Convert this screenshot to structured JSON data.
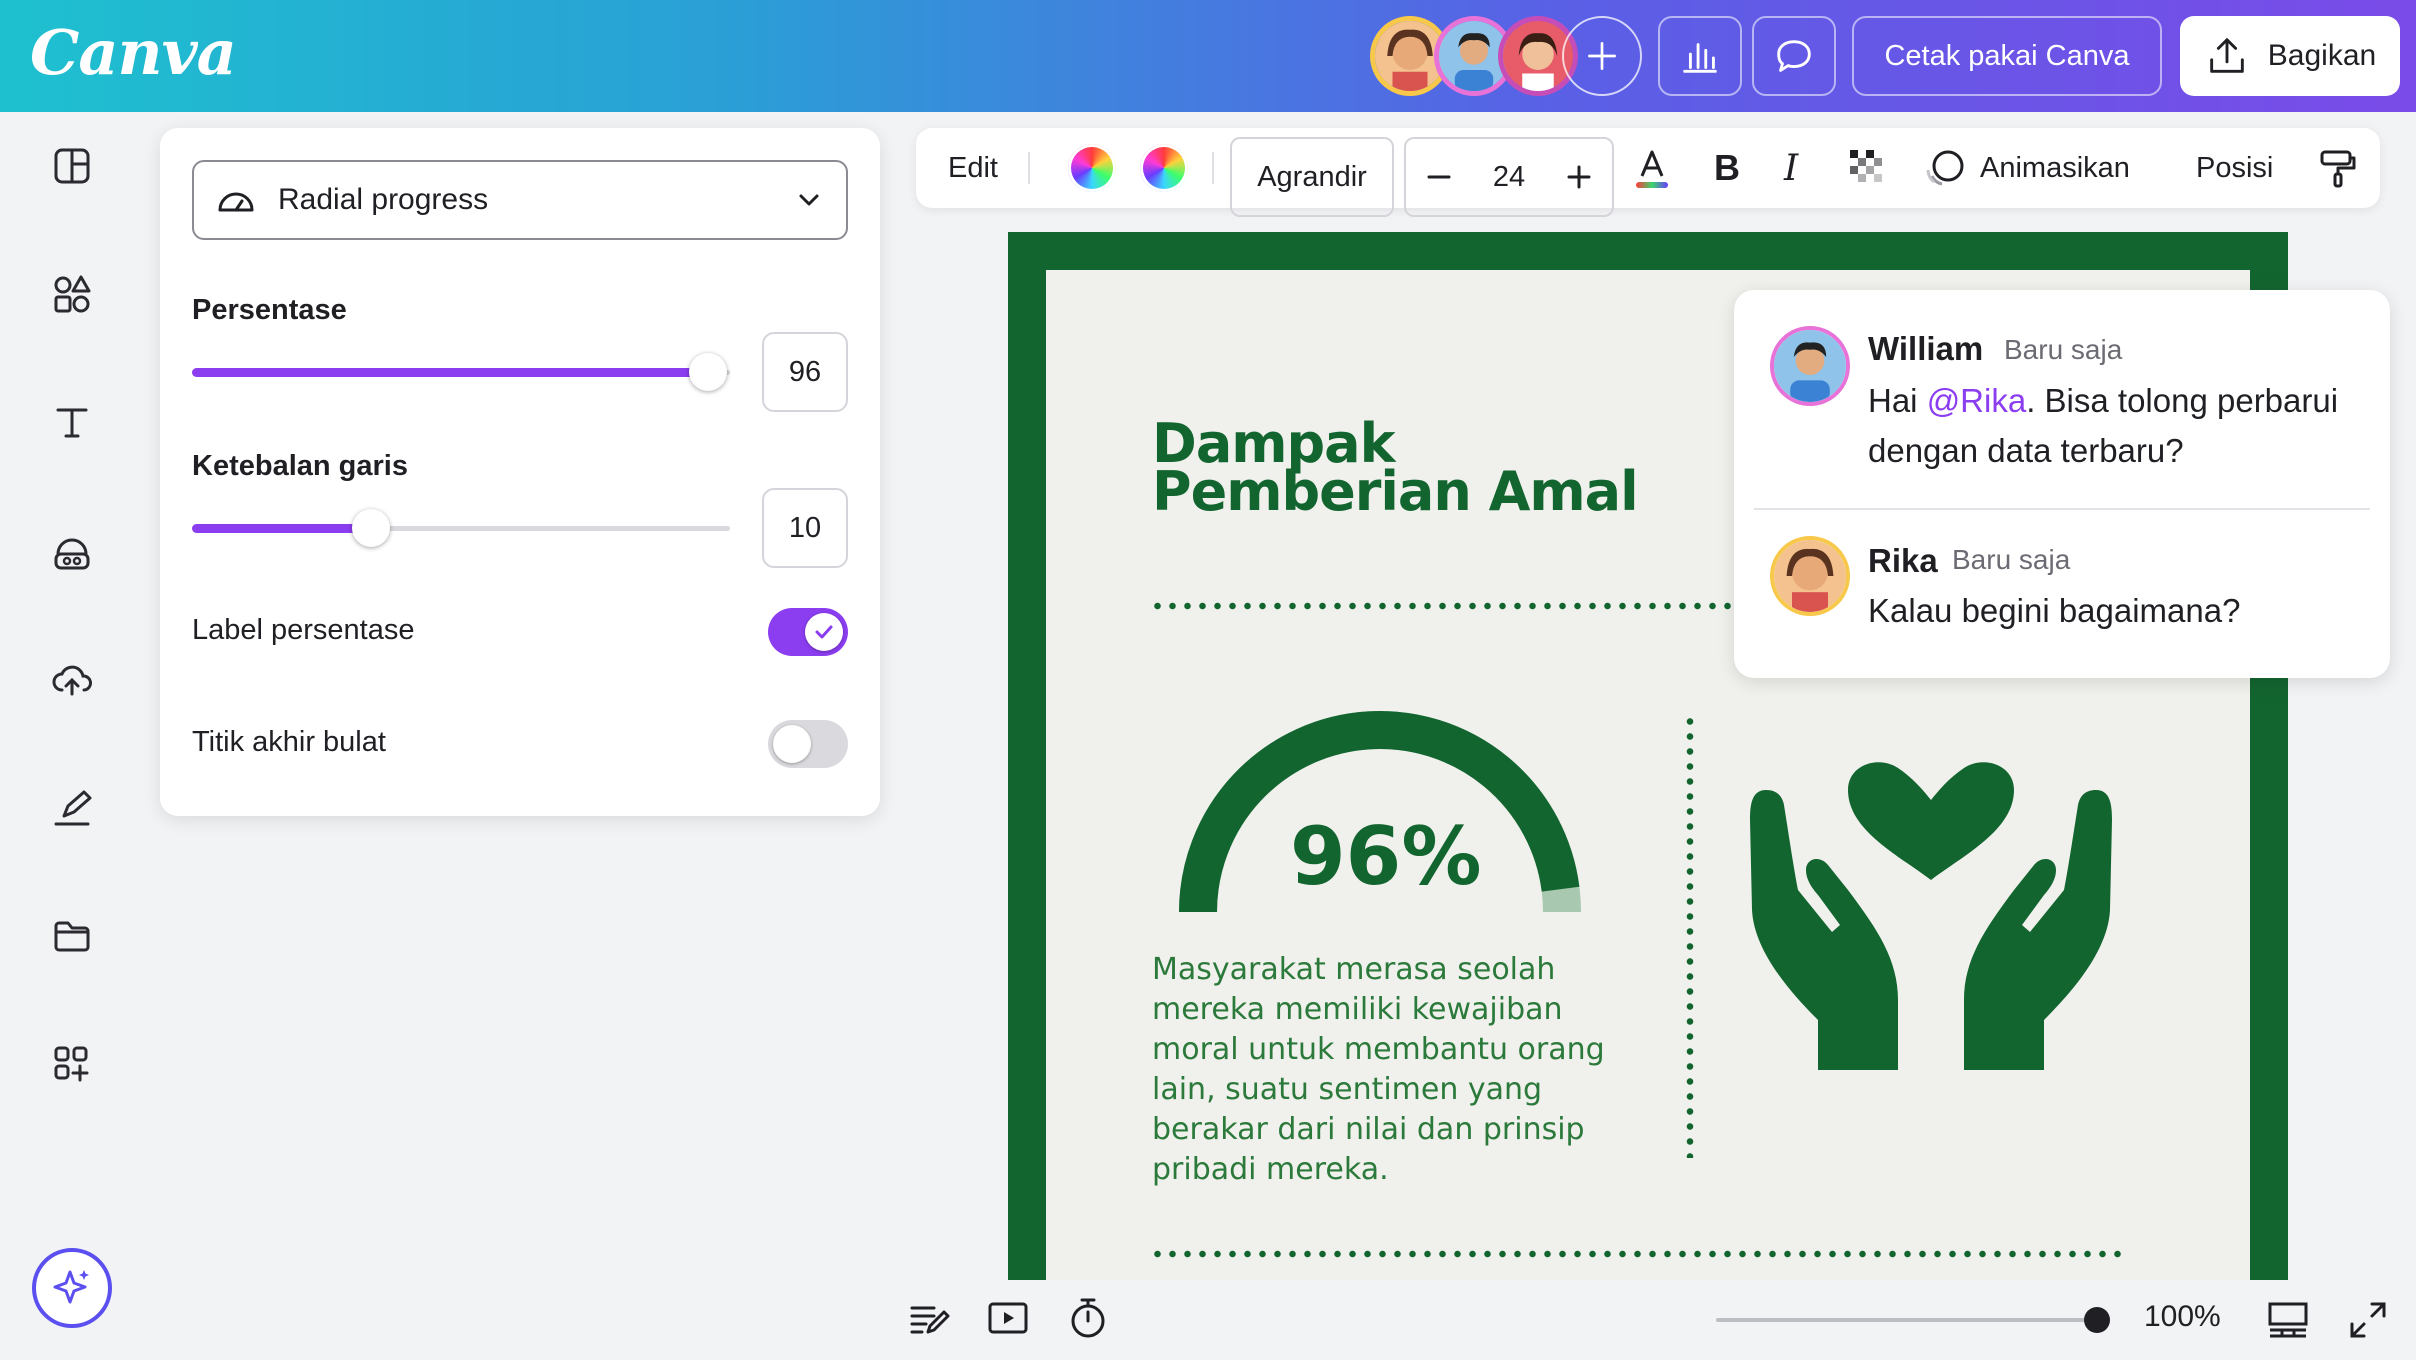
{
  "app": {
    "logo_text": "Canva"
  },
  "topbar": {
    "print_label": "Cetak pakai Canva",
    "share_label": "Bagikan",
    "icons": [
      "add-collaborator-icon",
      "insights-chart-icon",
      "comment-icon",
      "share-upload-icon"
    ]
  },
  "sidebar": {
    "items": [
      "design-icon",
      "elements-icon",
      "text-icon",
      "brand-icon",
      "uploads-icon",
      "draw-icon",
      "projects-icon",
      "apps-icon"
    ],
    "magic": "magic-sparkle-icon"
  },
  "panel": {
    "select_value": "Radial progress",
    "percentage_label": "Persentase",
    "percentage_value": "96",
    "percentage": 96,
    "thickness_label": "Ketebalan garis",
    "thickness_value": "10",
    "thickness": 10,
    "thickness_max": 30,
    "label_toggle_label": "Label persentase",
    "label_toggle_on": true,
    "round_toggle_label": "Titik akhir bulat",
    "round_toggle_on": false
  },
  "context_toolbar": {
    "edit_label": "Edit",
    "font_label": "Agrandir",
    "font_size": "24",
    "animate_label": "Animasikan",
    "position_label": "Posisi"
  },
  "design": {
    "title_line1": "Dampak",
    "title_line2": "Pemberian Amal",
    "percent_label": "96%",
    "progress": 0.96,
    "body": "Masyarakat merasa seolah mereka memiliki kewajiban moral untuk membantu orang lain, suatu sentimen yang berakar dari nilai dan prinsip pribadi mereka.",
    "colors": {
      "primary": "#136530",
      "background": "#f0f1ec",
      "track": "#a8c8b0"
    }
  },
  "comments": [
    {
      "name": "William",
      "time": "Baru saja",
      "text_before": "Hai ",
      "mention": "@Rika",
      "text_after": ". Bisa tolong perbarui dengan data terbaru?"
    },
    {
      "name": "Rika",
      "time": "Baru saja",
      "text": "Kalau begini bagaimana?"
    }
  ],
  "bottombar": {
    "zoom": "100%",
    "icons": [
      "notes-icon",
      "present-icon",
      "timer-icon",
      "grid-view-icon",
      "fullscreen-icon"
    ]
  },
  "accent_color": "#8b3df0"
}
